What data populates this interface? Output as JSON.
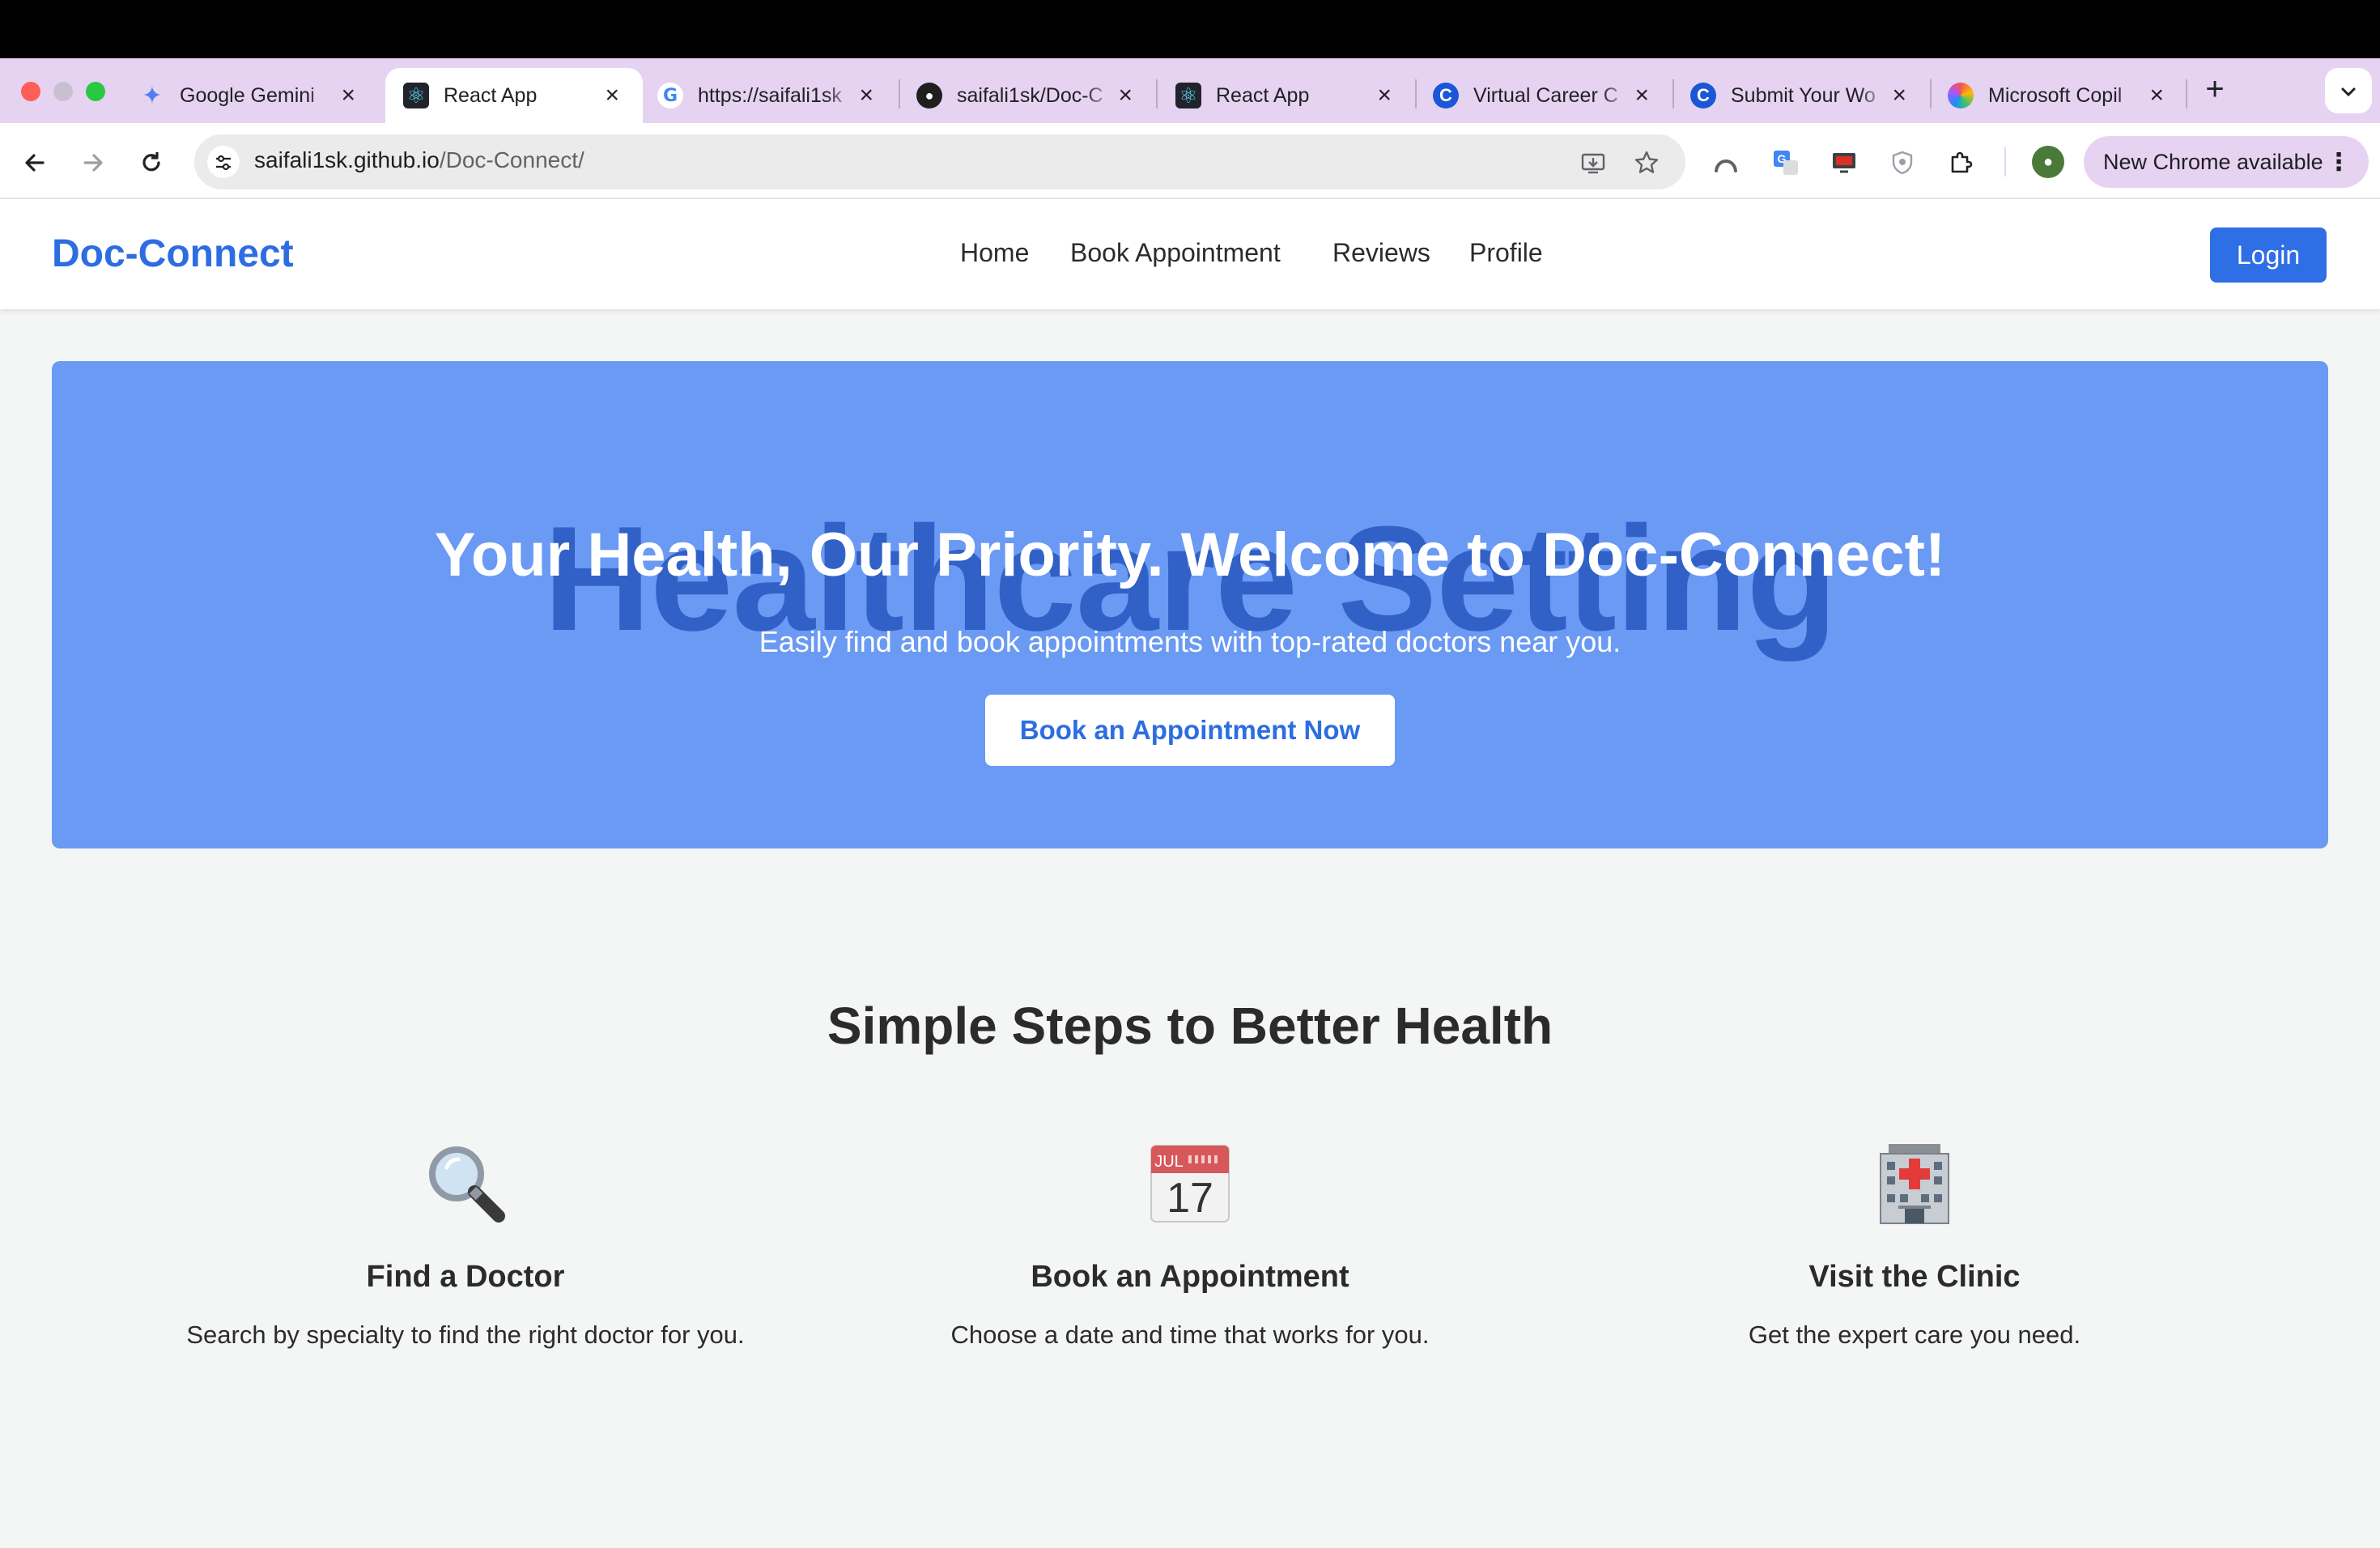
{
  "browser": {
    "tabs": [
      {
        "title": "Google Gemini",
        "icon": "gemini-icon",
        "active": false
      },
      {
        "title": "React App",
        "icon": "react-icon",
        "active": true
      },
      {
        "title": "https://saifali1sk",
        "icon": "google-icon",
        "active": false
      },
      {
        "title": "saifali1sk/Doc-C",
        "icon": "github-icon",
        "active": false
      },
      {
        "title": "React App",
        "icon": "react-icon",
        "active": false
      },
      {
        "title": "Virtual Career C",
        "icon": "c-logo-icon",
        "active": false
      },
      {
        "title": "Submit Your Wo",
        "icon": "c-logo-icon",
        "active": false
      },
      {
        "title": "Microsoft Copil",
        "icon": "copilot-icon",
        "active": false
      }
    ],
    "close_glyph": "×",
    "new_tab_glyph": "+",
    "url_host": "saifali1sk.github.io",
    "url_path": "/Doc-Connect/",
    "update_label": "New Chrome available",
    "update_menu_glyph": "⋮"
  },
  "app": {
    "brand": "Doc-Connect",
    "nav": [
      "Home",
      "Book Appointment",
      "Reviews",
      "Profile"
    ],
    "login_label": "Login",
    "hero": {
      "image_alt": "Healthcare Setting",
      "title": "Your Health, Our Priority. Welcome to Doc-Connect!",
      "subtitle": "Easily find and book appointments with top-rated doctors near you.",
      "cta_label": "Book an Appointment Now"
    },
    "steps_title": "Simple Steps to Better Health",
    "steps": [
      {
        "icon": "magnifying-glass-icon",
        "title": "Find a Doctor",
        "description": "Search by specialty to find the right doctor for you."
      },
      {
        "icon": "calendar-icon",
        "calendar_month": "JUL",
        "calendar_day": "17",
        "title": "Book an Appointment",
        "description": "Choose a date and time that works for you."
      },
      {
        "icon": "hospital-icon",
        "title": "Visit the Clinic",
        "description": "Get the expert care you need."
      }
    ]
  },
  "colors": {
    "brand_blue": "#2d6de2",
    "hero_blue": "#6a9af3",
    "tabstrip": "#e6d3f2"
  }
}
